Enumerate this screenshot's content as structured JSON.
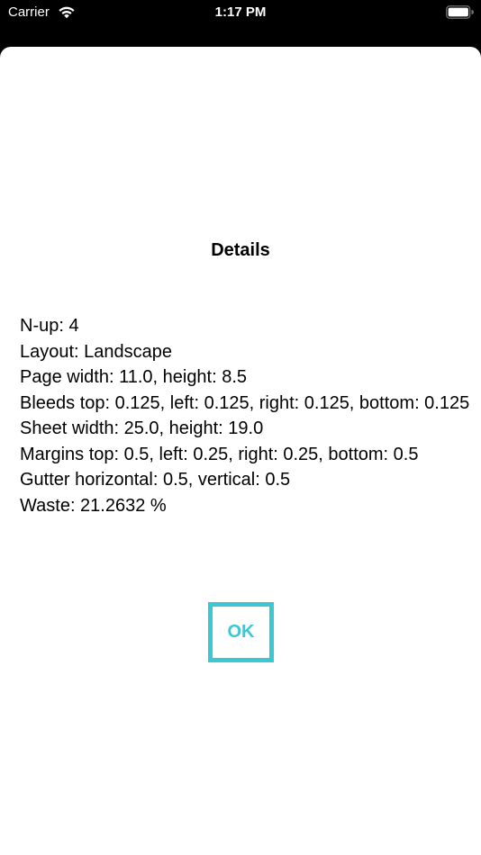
{
  "status_bar": {
    "carrier": "Carrier",
    "time": "1:17 PM",
    "wifi_icon": "wifi-icon",
    "battery_icon": "battery-full-icon"
  },
  "dialog": {
    "title": "Details",
    "lines": [
      "N-up: 4",
      "Layout: Landscape",
      "Page width: 11.0, height: 8.5",
      "Bleeds top: 0.125, left: 0.125, right: 0.125, bottom: 0.125",
      "Sheet width: 25.0, height: 19.0",
      "Margins top: 0.5, left: 0.25, right: 0.25, bottom: 0.5",
      "Gutter horizontal: 0.5, vertical: 0.5",
      "Waste: 21.2632 %"
    ],
    "ok_label": "OK"
  },
  "colors": {
    "accent": "#3ac8d2",
    "background": "#000000",
    "sheet": "#ffffff"
  }
}
